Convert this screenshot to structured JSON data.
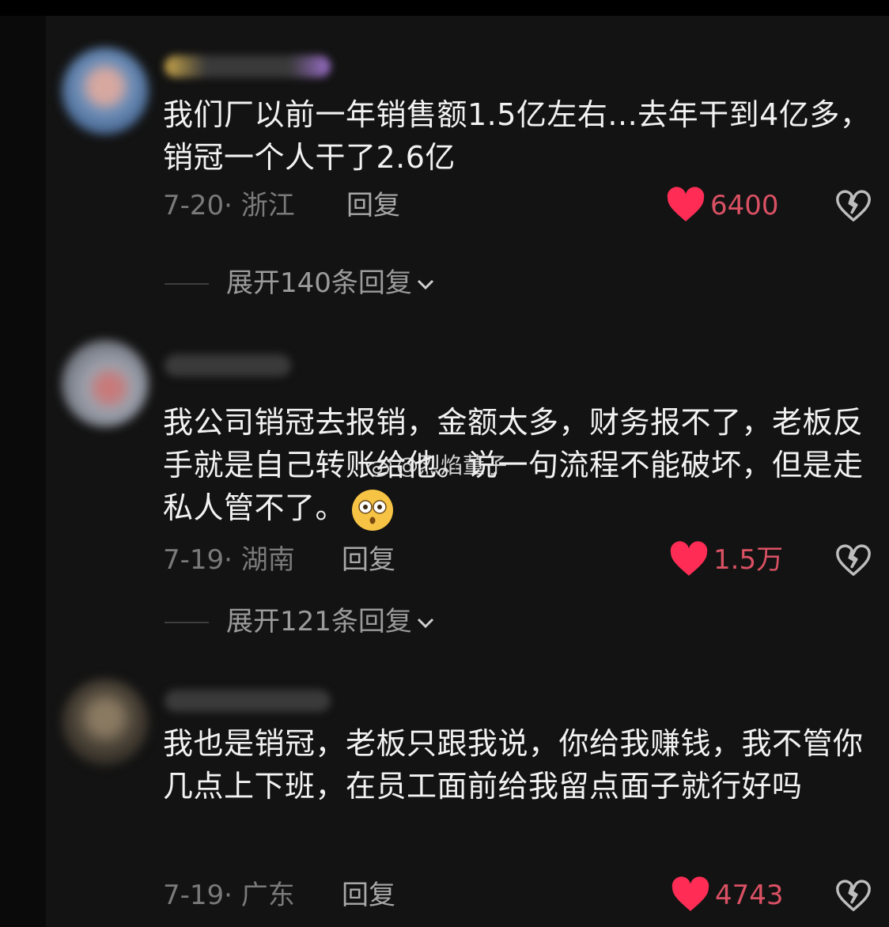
{
  "comments": [
    {
      "text": "我们厂以前一年销售额1.5亿左右...去年干到4亿多，销冠一个人干了2.6亿",
      "date_location": "7-20· 浙江",
      "reply_label": "回复",
      "likes": "6400",
      "expand_label": "展开140条回复"
    },
    {
      "text": "我公司销冠去报销，金额太多，财务报不了，老板反手就是自己转账给他。说一句流程不能破坏，但是走私人管不了。",
      "emoji": "flushed-face-emoji",
      "date_location": "7-19· 湖南",
      "reply_label": "回复",
      "likes": "1.5万",
      "expand_label": "展开121条回复"
    },
    {
      "text": "我也是销冠，老板只跟我说，你给我赚钱，我不管你几点上下班，在员工面前给我留点面子就行好吗",
      "date_location": "7-19· 广东",
      "reply_label": "回复",
      "likes": "4743"
    }
  ],
  "watermark": "@烈焰董子",
  "colors": {
    "background": "#131313",
    "text": "#f2f2f2",
    "meta": "#7a7a7a",
    "like": "#ff2d55"
  },
  "icons": [
    "heart-icon",
    "broken-heart-icon",
    "chevron-down-icon",
    "weibo-icon"
  ]
}
